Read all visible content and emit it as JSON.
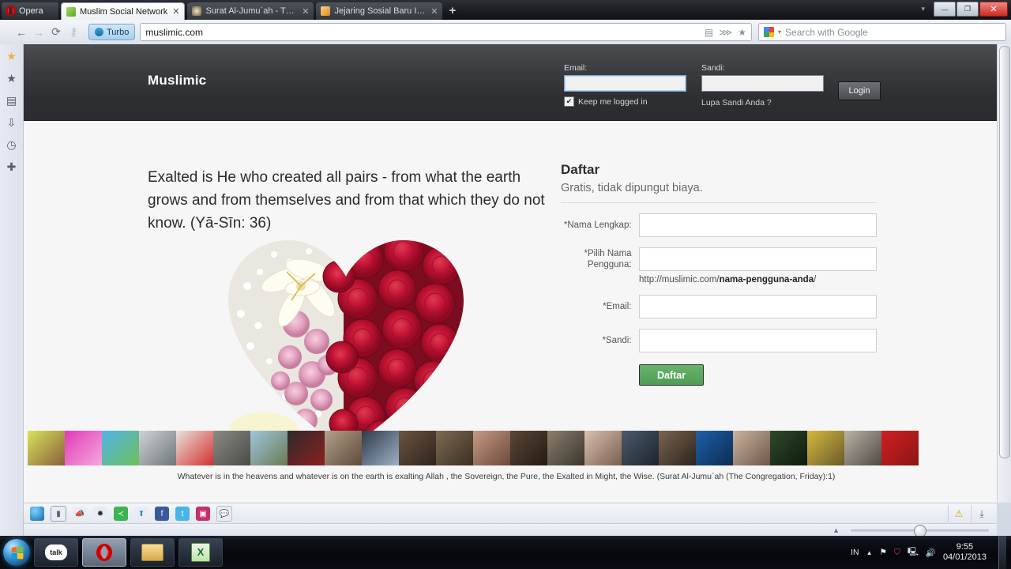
{
  "browser": {
    "app_name": "Opera",
    "tabs": [
      {
        "title": "Muslim Social Network",
        "favicon_color": "#7ac943",
        "active": true
      },
      {
        "title": "Surat Al-Jumu`ah - The...",
        "favicon_color": "#6b5b3e",
        "active": false
      },
      {
        "title": "Jejaring Sosial Baru Ind...",
        "favicon_color": "#e8a33d",
        "active": false
      }
    ],
    "new_tab_label": "+",
    "window_controls": {
      "minimize": "—",
      "restore": "❐",
      "close": "✕",
      "menu_caret": "▾"
    },
    "nav": {
      "back": "←",
      "forward": "→",
      "reload": "⟳",
      "security": "⚷",
      "turbo_label": "Turbo",
      "url": "muslimic.com",
      "right_icons": [
        "briefcase-icon",
        "rss-icon",
        "star-icon"
      ]
    },
    "search": {
      "placeholder": "Search with Google"
    },
    "panel_icons": [
      "speed-dial-icon",
      "bookmarks-icon",
      "notes-icon",
      "downloads-icon",
      "history-icon",
      "add-panel-icon"
    ],
    "status_share_icons": [
      "globe-icon",
      "window-icon",
      "megaphone-icon",
      "bug-icon",
      "share-icon",
      "upload-icon",
      "facebook-icon",
      "twitter-icon",
      "flickr-icon",
      "comment-icon"
    ],
    "status_right_icons": [
      "warning-icon",
      "download-icon"
    ],
    "zoom_level": "100%"
  },
  "site": {
    "brand": "Muslimic",
    "login": {
      "email_label": "Email:",
      "email_value": "",
      "password_label": "Sandi:",
      "password_value": "",
      "keep_logged_label": "Keep me logged in",
      "keep_logged_checked": true,
      "forgot_link": "Lupa Sandi Anda ?",
      "login_button": "Login"
    },
    "hero": {
      "quote": "Exalted is He who created all pairs - from what the earth grows and from themselves and from that which they do not know. (Yā-Sīn: 36)",
      "image_name": "heart-bouquet-roses-image"
    },
    "register": {
      "title": "Daftar",
      "subtitle": "Gratis, tidak dipungut biaya.",
      "fields": [
        {
          "label": "*Nama Lengkap:",
          "value": "",
          "name": "full-name-field"
        },
        {
          "label": "*Pilih Nama Pengguna:",
          "value": "",
          "name": "username-field"
        },
        {
          "label": "*Email:",
          "value": "",
          "name": "register-email-field"
        },
        {
          "label": "*Sandi:",
          "value": "",
          "name": "register-password-field"
        }
      ],
      "url_hint_prefix": "http://muslimic.com/",
      "url_hint_bold": "nama-pengguna-anda",
      "url_hint_suffix": "/",
      "submit_button": "Daftar",
      "accent_color": "#57a55e"
    },
    "footer_caption": "Whatever is in the heavens and whatever is on the earth is exalting Allah , the Sovereign, the Pure, the Exalted in Might, the Wise. (Surat Al-Jumu`ah (The Congregation, Friday):1)",
    "thumbnails": [
      {
        "name": "thumb-person-yellow",
        "c1": "#d8e45a",
        "c2": "#8a5f3c"
      },
      {
        "name": "thumb-letter-m-pink",
        "c1": "#e23ab8",
        "c2": "#f4a8dd"
      },
      {
        "name": "thumb-world-map",
        "c1": "#4fb3e8",
        "c2": "#6fbf5a"
      },
      {
        "name": "thumb-car-white",
        "c1": "#cfd3d6",
        "c2": "#6e7679"
      },
      {
        "name": "thumb-no-zina",
        "c1": "#e8e4de",
        "c2": "#d32f2f"
      },
      {
        "name": "thumb-engine-grey",
        "c1": "#8b8b86",
        "c2": "#4a4a46"
      },
      {
        "name": "thumb-building",
        "c1": "#9fc6dd",
        "c2": "#6b7a54"
      },
      {
        "name": "thumb-book-cover-dark",
        "c1": "#2b2b2b",
        "c2": "#8c1f1f"
      },
      {
        "name": "thumb-person-1",
        "c1": "#b3a18c",
        "c2": "#5f4b38"
      },
      {
        "name": "thumb-woman-hijab-1",
        "c1": "#2e3a4c",
        "c2": "#9fb0c4"
      },
      {
        "name": "thumb-man-1",
        "c1": "#6b5442",
        "c2": "#2e241c"
      },
      {
        "name": "thumb-indoor-1",
        "c1": "#7d6a52",
        "c2": "#3a2f24"
      },
      {
        "name": "thumb-woman-2",
        "c1": "#c79a84",
        "c2": "#6a4a3c"
      },
      {
        "name": "thumb-man-2",
        "c1": "#5a4636",
        "c2": "#241c15"
      },
      {
        "name": "thumb-group-1",
        "c1": "#8a7f6e",
        "c2": "#3b352c"
      },
      {
        "name": "thumb-woman-3",
        "c1": "#d9c0b0",
        "c2": "#7b5f4e"
      },
      {
        "name": "thumb-person-2",
        "c1": "#4a5a6b",
        "c2": "#1d242c"
      },
      {
        "name": "thumb-man-3",
        "c1": "#7a6450",
        "c2": "#2c241c"
      },
      {
        "name": "thumb-allah-calligraphy",
        "c1": "#1f5fa8",
        "c2": "#0c2d55"
      },
      {
        "name": "thumb-woman-hijab-2",
        "c1": "#cbb39f",
        "c2": "#6d5748"
      },
      {
        "name": "thumb-man-green",
        "c1": "#2f4a2a",
        "c2": "#0f1a0d"
      },
      {
        "name": "thumb-boys-yellow",
        "c1": "#d6b93f",
        "c2": "#6a5a2a"
      },
      {
        "name": "thumb-family",
        "c1": "#b9b2a6",
        "c2": "#4f4a42"
      },
      {
        "name": "thumb-man-red-bg",
        "c1": "#cf2020",
        "c2": "#8d1515"
      }
    ]
  },
  "taskbar": {
    "start_label": "Start",
    "buttons": [
      {
        "name": "taskbar-google-talk",
        "label": "talk"
      },
      {
        "name": "taskbar-opera",
        "label": "O"
      },
      {
        "name": "taskbar-explorer",
        "label": "folder"
      },
      {
        "name": "taskbar-excel",
        "label": "X"
      }
    ],
    "tray": {
      "language": "IN",
      "expand": "▲",
      "icons": [
        "flag-alert-icon",
        "security-alert-icon",
        "network-icon",
        "volume-icon"
      ],
      "time": "9:55",
      "date": "04/01/2013"
    }
  }
}
